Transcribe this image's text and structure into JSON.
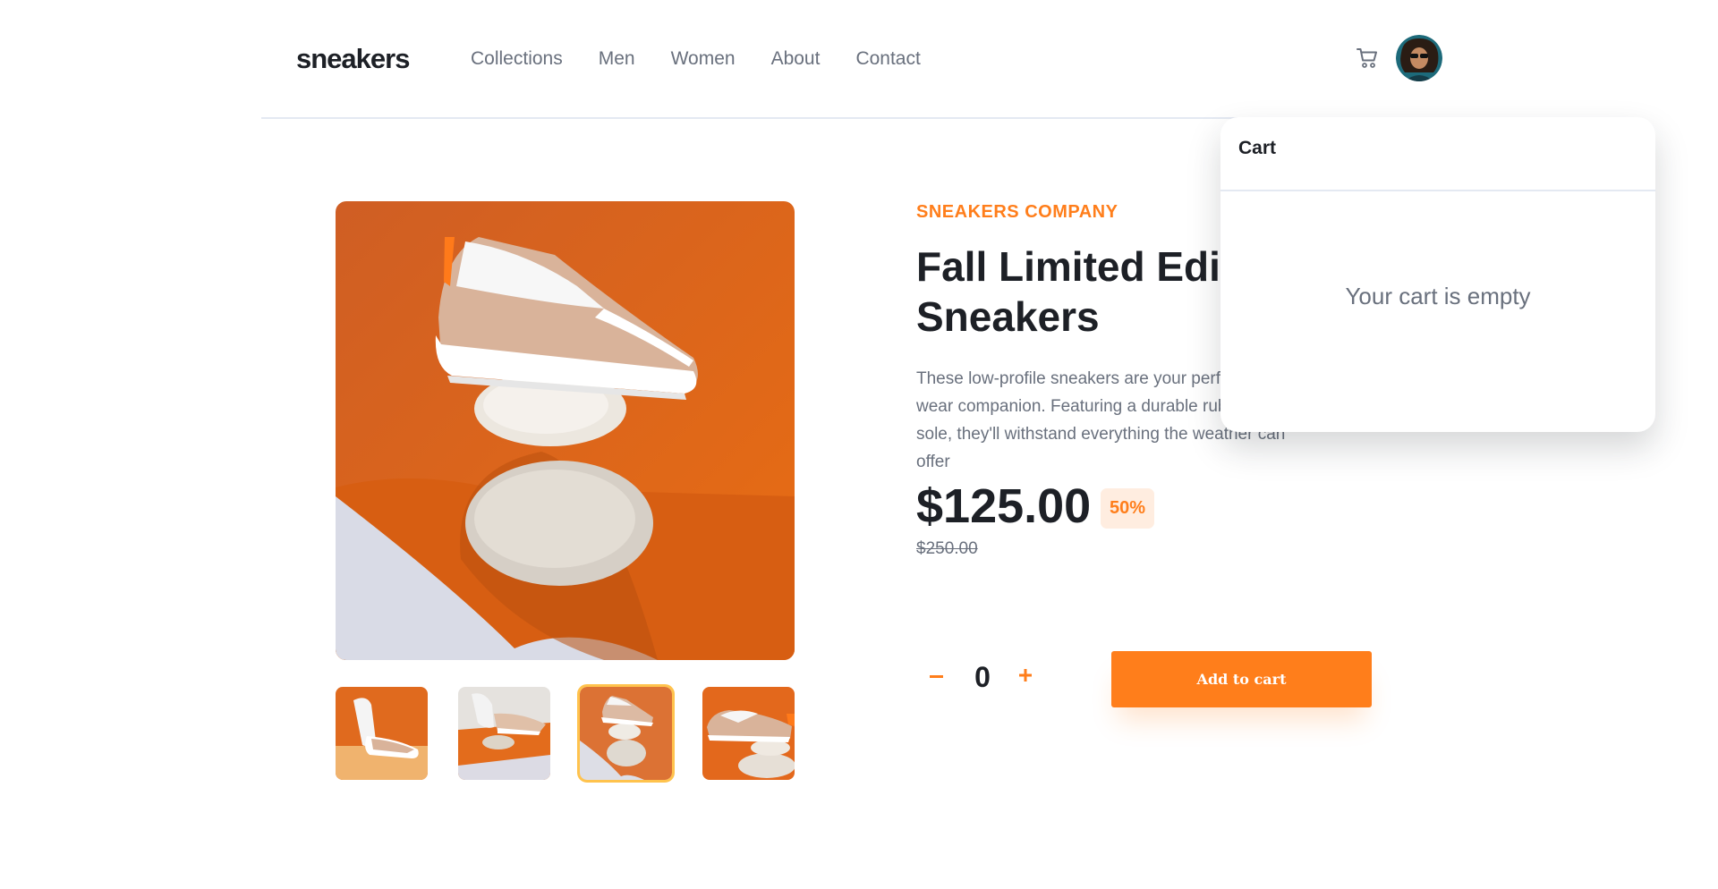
{
  "header": {
    "logo": "sneakers",
    "nav": [
      "Collections",
      "Men",
      "Women",
      "About",
      "Contact"
    ],
    "icons": {
      "cart": "cart-icon",
      "avatar": "user-avatar"
    }
  },
  "gallery": {
    "thumbnail_count": 4,
    "active_thumbnail": 3
  },
  "product": {
    "company": "SNEAKERS COMPANY",
    "title": "Fall Limited Edition Sneakers",
    "description": "These low-profile sneakers are your perfect casual wear companion. Featuring a durable rubber outer sole, they'll withstand everything the weather can offer",
    "price": "$125.00",
    "discount": "50%",
    "old_price": "$250.00"
  },
  "quantity": {
    "value": "0",
    "minus_icon": "minus-icon",
    "plus_icon": "plus-icon"
  },
  "add_to_cart": {
    "label": "Add to cart"
  },
  "cart": {
    "title": "Cart",
    "empty_message": "Your cart is empty"
  },
  "colors": {
    "accent": "#ff7e1b",
    "accent_pale": "#ffede0",
    "dark": "#1d2026",
    "grey": "#69707d",
    "thumb_border": "#ffbd3a"
  }
}
